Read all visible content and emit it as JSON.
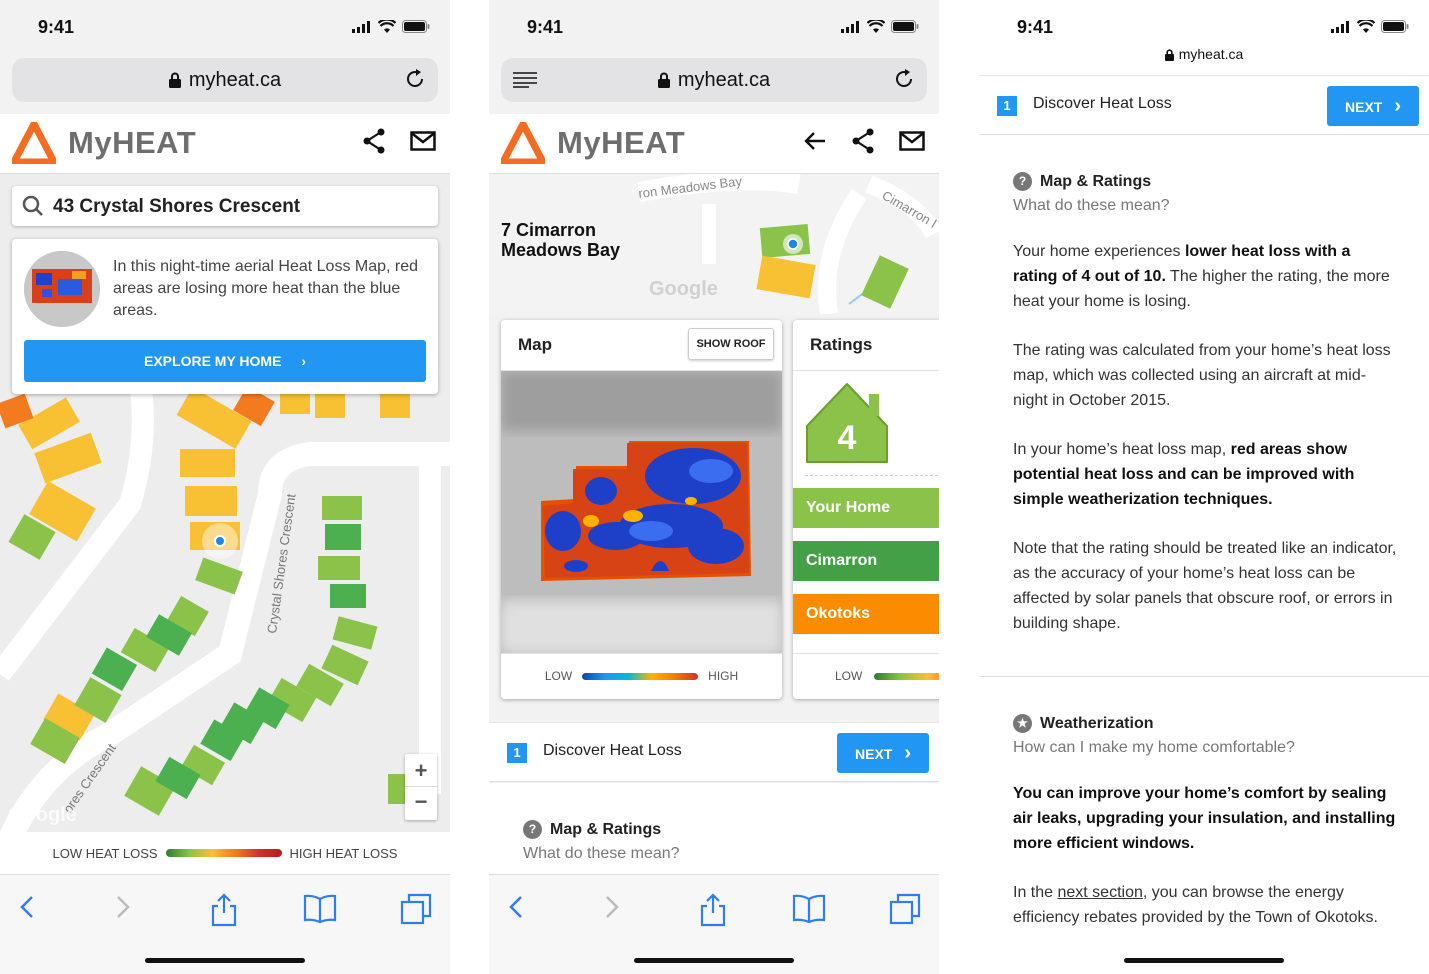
{
  "status": {
    "time": "9:41"
  },
  "browser": {
    "url": "myheat.ca"
  },
  "brand": {
    "name": "MyHEAT",
    "accent": "#f36c21"
  },
  "screen1": {
    "search_value": "43 Crystal Shores Crescent",
    "card_text": "In this night-time aerial Heat Loss Map, red areas are losing more heat than the blue areas.",
    "explore_label": "EXPLORE MY HOME",
    "street1": "Crystal Shores Crescent",
    "street2": "ores Crescent",
    "google": "Google",
    "zoom_in": "+",
    "zoom_out": "−",
    "legend_low": "LOW HEAT LOSS",
    "legend_high": "HIGH HEAT LOSS"
  },
  "screen2": {
    "address_line1": "7 Cimarron",
    "address_line2": "Meadows Bay",
    "street1": "ron Meadows Bay",
    "street2": "Cimarron I",
    "google": "Google",
    "map_title": "Map",
    "show_roof": "SHOW ROOF",
    "map_low": "LOW",
    "map_high": "HIGH",
    "ratings_title": "Ratings",
    "rating_value": "4",
    "rows": [
      {
        "label": "Your Home",
        "color": "#8bc34a"
      },
      {
        "label": "Cimarron",
        "color": "#43a047"
      },
      {
        "label": "Okotoks",
        "color": "#fb8c00"
      }
    ],
    "ratings_low": "LOW",
    "step_num": "1",
    "step_title": "Discover Heat Loss",
    "next_label": "NEXT",
    "section_title": "Map & Ratings",
    "section_sub": "What do these mean?"
  },
  "screen3": {
    "step_num": "1",
    "step_title": "Discover Heat Loss",
    "next_label": "NEXT",
    "s1_title": "Map & Ratings",
    "s1_sub": "What do these mean?",
    "p1_a": "Your home experiences ",
    "p1_b": "lower heat loss with a rating of 4 out of 10.",
    "p1_c": " The higher the rating, the more heat your home is losing.",
    "p2": "The rating was calculated from your home’s heat loss map, which was collected using an aircraft at mid-night in October 2015.",
    "p3_a": "In your home’s heat loss map, ",
    "p3_b": "red areas show potential heat loss and can be improved with simple weatherization techniques.",
    "p4": "Note that the rating should be treated like an indicator, as the accuracy of your home’s heat loss can be affected by solar panels that obscure roof, or errors in building shape.",
    "s2_title": "Weatherization",
    "s2_sub": "How can I make my home comfortable?",
    "p5": "You can improve your home’s comfort by sealing air leaks, upgrading your insulation, and installing more efficient windows.",
    "p6_a": "In the ",
    "p6_link": "next section",
    "p6_b": ", you can browse the energy efficiency rebates provided by the Town of Okotoks."
  }
}
